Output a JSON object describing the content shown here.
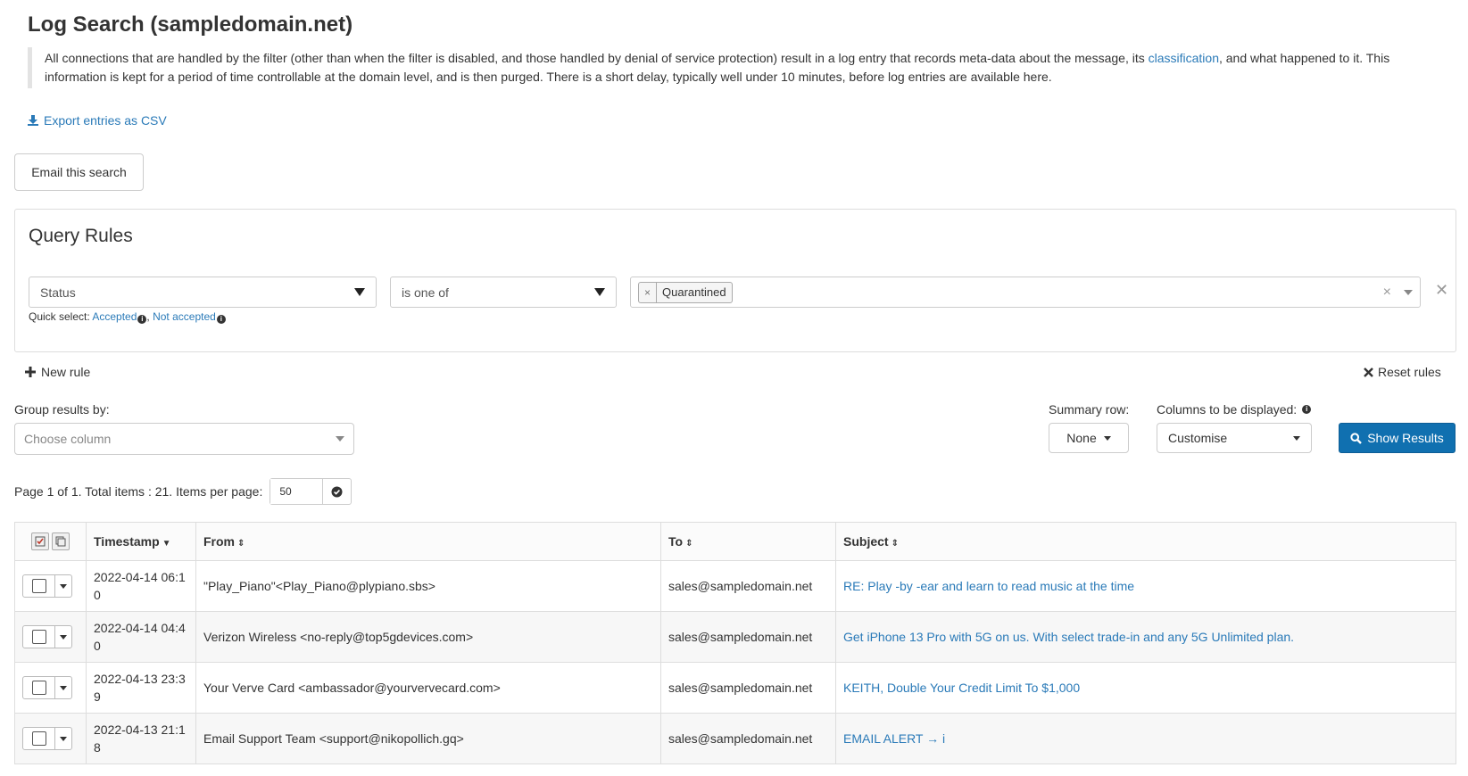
{
  "page": {
    "title": "Log Search (sampledomain.net)",
    "intro_before": "All connections that are handled by the filter (other than when the filter is disabled, and those handled by denial of service protection) result in a log entry that records meta-data about the message, its ",
    "intro_link": "classification",
    "intro_after": ", and what happened to it. This information is kept for a period of time controllable at the domain level, and is then purged. There is a short delay, typically well under 10 minutes, before log entries are available here.",
    "export_label": "Export entries as CSV",
    "email_search_label": "Email this search"
  },
  "query": {
    "title": "Query Rules",
    "field": "Status",
    "operator": "is one of",
    "values": [
      "Quarantined"
    ],
    "quick_select_label": "Quick select: ",
    "quick_accepted": "Accepted",
    "quick_separator": ", ",
    "quick_not_accepted": "Not accepted",
    "new_rule_label": "New rule",
    "reset_rules_label": "Reset rules"
  },
  "controls": {
    "group_by_label": "Group results by:",
    "group_by_placeholder": "Choose column",
    "summary_row_label": "Summary row:",
    "summary_row_value": "None",
    "columns_label": "Columns to be displayed:",
    "columns_value": "Customise",
    "show_results_label": "Show Results"
  },
  "pager": {
    "text": "Page 1 of 1. Total items : 21. Items per page:",
    "items_per_page": "50"
  },
  "table": {
    "headers": {
      "timestamp": "Timestamp",
      "from": "From",
      "to": "To",
      "subject": "Subject"
    },
    "rows": [
      {
        "timestamp": "2022-04-14 06:10",
        "from": "\"Play_Piano\"<Play_Piano@plypiano.sbs>",
        "to": "sales@sampledomain.net",
        "subject": "RE: Play -by -ear and learn to read music at the time"
      },
      {
        "timestamp": "2022-04-14 04:40",
        "from": "Verizon Wireless <no-reply@top5gdevices.com>",
        "to": "sales@sampledomain.net",
        "subject": "Get iPhone 13 Pro with 5G on us. With select trade-in and any 5G Unlimited plan."
      },
      {
        "timestamp": "2022-04-13 23:39",
        "from": "Your Verve Card <ambassador@yourvervecard.com>",
        "to": "sales@sampledomain.net",
        "subject": "KEITH, Double Your Credit Limit To $1,000"
      },
      {
        "timestamp": "2022-04-13 21:18",
        "from": "Email Support Team <support@nikopollich.gq>",
        "to": "sales@sampledomain.net",
        "subject": "EMAIL ALERT → i"
      }
    ]
  },
  "colors": {
    "link": "#2a7ab8",
    "primary_button": "#1070b0"
  }
}
